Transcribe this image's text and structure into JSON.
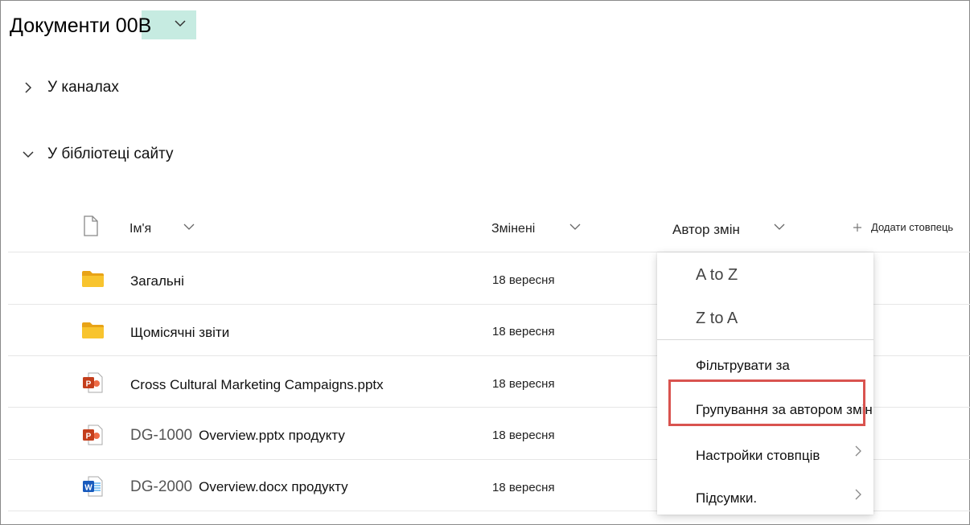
{
  "library": {
    "title": "Документи 00В"
  },
  "sections": [
    {
      "label": "У каналах",
      "expanded": false
    },
    {
      "label": "У бібліотеці сайту",
      "expanded": true
    }
  ],
  "columns": {
    "name": "Ім'я",
    "modified": "Змінені",
    "modified_by": "Автор змін",
    "add_column": "Додати стовпець"
  },
  "rows": [
    {
      "type": "folder",
      "prefix": "",
      "name": "Загальні",
      "modified": "18 вересня"
    },
    {
      "type": "folder",
      "prefix": "",
      "name": "Щомісячні звіти",
      "modified": "18 вересня"
    },
    {
      "type": "pptx",
      "prefix": "",
      "name": "Cross Cultural Marketing Campaigns.pptx",
      "modified": "18 вересня"
    },
    {
      "type": "pptx",
      "prefix": "DG-1000",
      "name": "Overview.pptx продукту",
      "modified": "18 вересня"
    },
    {
      "type": "docx",
      "prefix": "DG-2000",
      "name": "Overview.docx продукту",
      "modified": "18 вересня"
    }
  ],
  "menu": {
    "sort_asc": "A to Z",
    "sort_desc": "Z to A",
    "filter": "Фільтрувати за",
    "group_by": "Групування за автором змін",
    "column_settings": "Настройки стовпців",
    "totals": "Підсумки."
  },
  "colors": {
    "title_highlight": "#c6ebe1",
    "folder": "#f8c42e",
    "powerpoint": "#c43e1c",
    "word": "#185abd",
    "callout": "#d9534f"
  }
}
